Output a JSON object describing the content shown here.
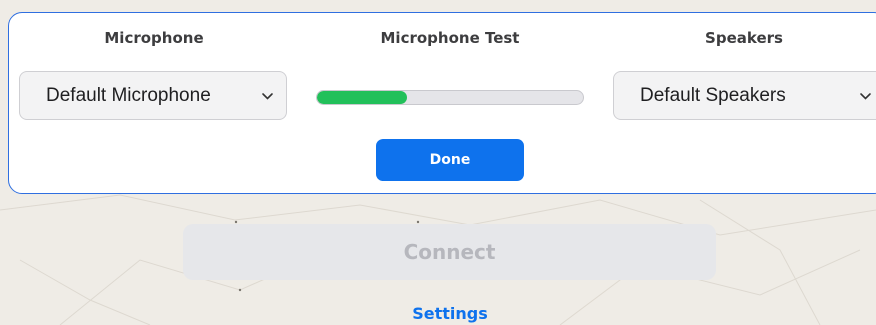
{
  "dialog": {
    "microphone": {
      "title": "Microphone",
      "selected": "Default Microphone",
      "chevron_icon": "chevron-down-icon"
    },
    "test": {
      "title": "Microphone Test",
      "level_percent": 34,
      "level_color": "#22c05a"
    },
    "speakers": {
      "title": "Speakers",
      "selected": "Default Speakers",
      "chevron_icon": "chevron-down-icon"
    },
    "done_label": "Done",
    "accent_color": "#0e72ed"
  },
  "page": {
    "connect_label": "Connect",
    "settings_label": "Settings"
  }
}
